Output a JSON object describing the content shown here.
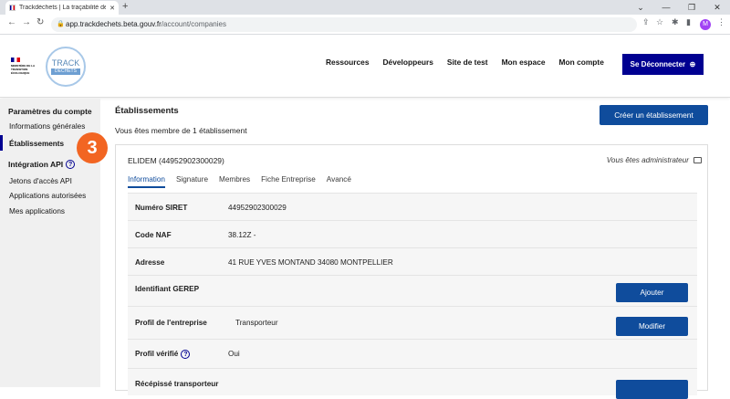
{
  "browser": {
    "tab_title": "Trackdéchets | La traçabilité des",
    "url_domain": "app.trackdechets.beta.gouv.fr",
    "url_path": "/account/companies",
    "avatar_letter": "M"
  },
  "header": {
    "logo_top": "TRACK",
    "logo_sub": "DÉCHETS",
    "ministry": "MINISTÈRE DE LA TRANSITION ÉCOLOGIQUE",
    "nav": [
      "Ressources",
      "Développeurs",
      "Site de test",
      "Mon espace",
      "Mon compte"
    ],
    "logout_label": "Se Déconnecter"
  },
  "sidebar": {
    "section1": "Paramètres du compte",
    "item_general": "Informations générales",
    "item_establishments": "Établissements",
    "section2": "Intégration API",
    "item_tokens": "Jetons d'accès API",
    "item_apps_auth": "Applications autorisées",
    "item_my_apps": "Mes applications",
    "step_badge": "3"
  },
  "main": {
    "title": "Établissements",
    "member_text": "Vous êtes membre de 1 établissement",
    "create_button": "Créer un établissement",
    "company": {
      "title": "ELIDEM (44952902300029)",
      "role": "Vous êtes administrateur",
      "tabs": [
        "Information",
        "Signature",
        "Membres",
        "Fiche Entreprise",
        "Avancé"
      ],
      "rows": [
        {
          "label": "Numéro SIRET",
          "value": "44952902300029"
        },
        {
          "label": "Code NAF",
          "value": "38.12Z -"
        },
        {
          "label": "Adresse",
          "value": "41 RUE YVES MONTAND 34080 MONTPELLIER"
        },
        {
          "label": "Identifiant GEREP",
          "value": "",
          "action": "Ajouter"
        },
        {
          "label": "Profil de l'entreprise",
          "value": "Transporteur",
          "action": "Modifier"
        },
        {
          "label": "Profil vérifié",
          "value": "Oui"
        },
        {
          "label": "Récépissé transporteur",
          "value": ""
        }
      ]
    }
  }
}
